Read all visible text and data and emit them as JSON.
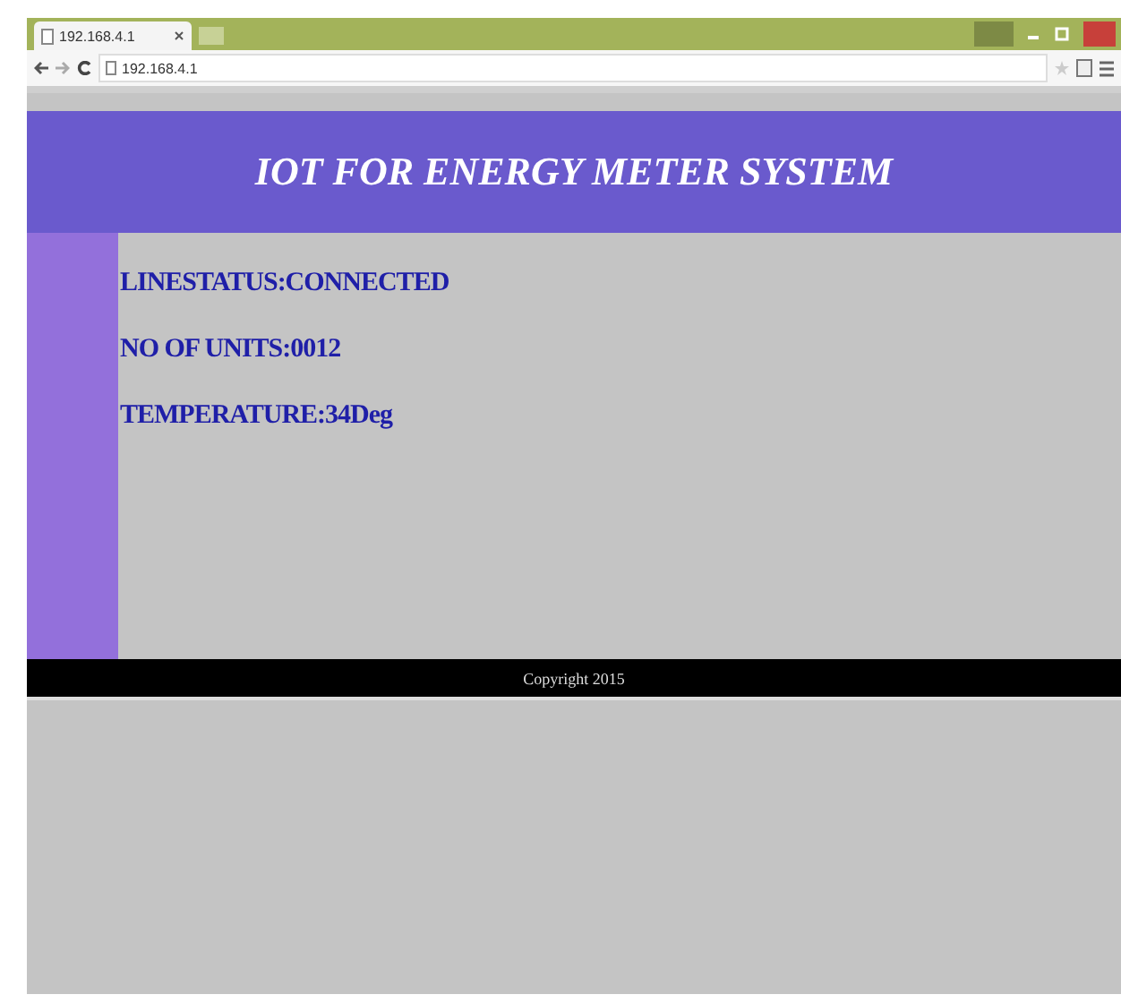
{
  "browser": {
    "tab_title": "192.168.4.1",
    "address": "192.168.4.1"
  },
  "page": {
    "title": "IOT FOR ENERGY METER SYSTEM",
    "readings": [
      "LINESTATUS:CONNECTED",
      "NO OF UNITS:0012",
      "TEMPERATURE:34Deg"
    ],
    "footer": "Copyright 2015"
  }
}
